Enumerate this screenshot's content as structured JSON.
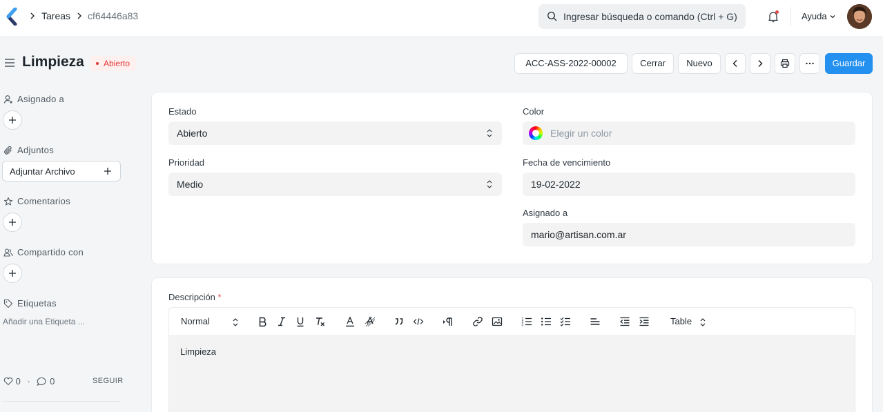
{
  "navbar": {
    "breadcrumbs": [
      "Tareas",
      "cf64446a83"
    ],
    "search_placeholder": "Ingresar búsqueda o comando (Ctrl + G)",
    "help_label": "Ayuda"
  },
  "page": {
    "title": "Limpieza",
    "status": "Abierto",
    "actions": {
      "linked_doc": "ACC-ASS-2022-00002",
      "close": "Cerrar",
      "new": "Nuevo",
      "save": "Guardar"
    }
  },
  "sidebar": {
    "assigned_heading": "Asignado a",
    "attachments_heading": "Adjuntos",
    "attach_button": "Adjuntar Archivo",
    "comments_heading": "Comentarios",
    "shared_heading": "Compartido con",
    "tags_heading": "Etiquetas",
    "add_tag": "Añadir una Etiqueta ...",
    "likes": "0",
    "comments_count": "0",
    "follow": "SEGUIR"
  },
  "form": {
    "estado": {
      "label": "Estado",
      "value": "Abierto"
    },
    "prioridad": {
      "label": "Prioridad",
      "value": "Medio"
    },
    "color": {
      "label": "Color",
      "placeholder": "Elegir un color"
    },
    "fecha": {
      "label": "Fecha de vencimiento",
      "value": "19-02-2022"
    },
    "asignado": {
      "label": "Asignado a",
      "value": "mario@artisan.com.ar"
    },
    "descripcion": {
      "label": "Descripción",
      "required_mark": "*"
    }
  },
  "editor": {
    "format_select": "Normal",
    "table_select": "Table",
    "content": "Limpieza"
  },
  "colors": {
    "primary": "#2490ef",
    "status_red": "#e03636",
    "field_bg": "#f3f3f3"
  }
}
